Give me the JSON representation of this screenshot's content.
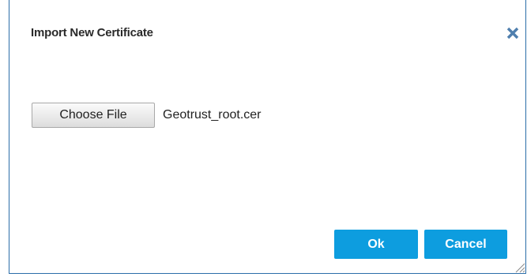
{
  "dialog": {
    "title": "Import New Certificate",
    "close_icon": "close-icon"
  },
  "file_input": {
    "button_label": "Choose File",
    "selected_file": "Geotrust_root.cer"
  },
  "actions": {
    "ok_label": "Ok",
    "cancel_label": "Cancel"
  },
  "colors": {
    "accent": "#0d9ddf",
    "border": "#2b6ea9",
    "close_icon": "#4f7fae"
  }
}
